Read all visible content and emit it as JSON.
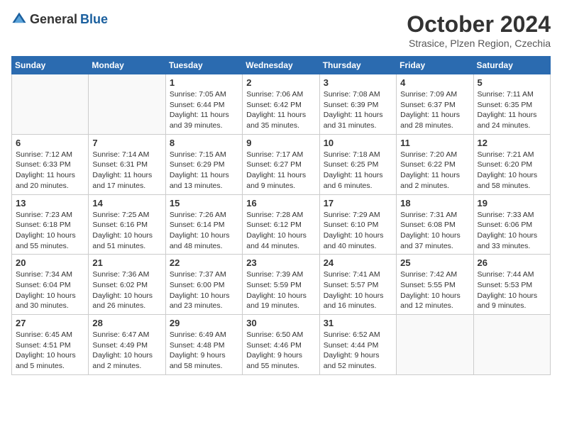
{
  "header": {
    "logo_general": "General",
    "logo_blue": "Blue",
    "month_title": "October 2024",
    "subtitle": "Strasice, Plzen Region, Czechia"
  },
  "calendar": {
    "days_of_week": [
      "Sunday",
      "Monday",
      "Tuesday",
      "Wednesday",
      "Thursday",
      "Friday",
      "Saturday"
    ],
    "weeks": [
      [
        {
          "day": "",
          "info": ""
        },
        {
          "day": "",
          "info": ""
        },
        {
          "day": "1",
          "info": "Sunrise: 7:05 AM\nSunset: 6:44 PM\nDaylight: 11 hours\nand 39 minutes."
        },
        {
          "day": "2",
          "info": "Sunrise: 7:06 AM\nSunset: 6:42 PM\nDaylight: 11 hours\nand 35 minutes."
        },
        {
          "day": "3",
          "info": "Sunrise: 7:08 AM\nSunset: 6:39 PM\nDaylight: 11 hours\nand 31 minutes."
        },
        {
          "day": "4",
          "info": "Sunrise: 7:09 AM\nSunset: 6:37 PM\nDaylight: 11 hours\nand 28 minutes."
        },
        {
          "day": "5",
          "info": "Sunrise: 7:11 AM\nSunset: 6:35 PM\nDaylight: 11 hours\nand 24 minutes."
        }
      ],
      [
        {
          "day": "6",
          "info": "Sunrise: 7:12 AM\nSunset: 6:33 PM\nDaylight: 11 hours\nand 20 minutes."
        },
        {
          "day": "7",
          "info": "Sunrise: 7:14 AM\nSunset: 6:31 PM\nDaylight: 11 hours\nand 17 minutes."
        },
        {
          "day": "8",
          "info": "Sunrise: 7:15 AM\nSunset: 6:29 PM\nDaylight: 11 hours\nand 13 minutes."
        },
        {
          "day": "9",
          "info": "Sunrise: 7:17 AM\nSunset: 6:27 PM\nDaylight: 11 hours\nand 9 minutes."
        },
        {
          "day": "10",
          "info": "Sunrise: 7:18 AM\nSunset: 6:25 PM\nDaylight: 11 hours\nand 6 minutes."
        },
        {
          "day": "11",
          "info": "Sunrise: 7:20 AM\nSunset: 6:22 PM\nDaylight: 11 hours\nand 2 minutes."
        },
        {
          "day": "12",
          "info": "Sunrise: 7:21 AM\nSunset: 6:20 PM\nDaylight: 10 hours\nand 58 minutes."
        }
      ],
      [
        {
          "day": "13",
          "info": "Sunrise: 7:23 AM\nSunset: 6:18 PM\nDaylight: 10 hours\nand 55 minutes."
        },
        {
          "day": "14",
          "info": "Sunrise: 7:25 AM\nSunset: 6:16 PM\nDaylight: 10 hours\nand 51 minutes."
        },
        {
          "day": "15",
          "info": "Sunrise: 7:26 AM\nSunset: 6:14 PM\nDaylight: 10 hours\nand 48 minutes."
        },
        {
          "day": "16",
          "info": "Sunrise: 7:28 AM\nSunset: 6:12 PM\nDaylight: 10 hours\nand 44 minutes."
        },
        {
          "day": "17",
          "info": "Sunrise: 7:29 AM\nSunset: 6:10 PM\nDaylight: 10 hours\nand 40 minutes."
        },
        {
          "day": "18",
          "info": "Sunrise: 7:31 AM\nSunset: 6:08 PM\nDaylight: 10 hours\nand 37 minutes."
        },
        {
          "day": "19",
          "info": "Sunrise: 7:33 AM\nSunset: 6:06 PM\nDaylight: 10 hours\nand 33 minutes."
        }
      ],
      [
        {
          "day": "20",
          "info": "Sunrise: 7:34 AM\nSunset: 6:04 PM\nDaylight: 10 hours\nand 30 minutes."
        },
        {
          "day": "21",
          "info": "Sunrise: 7:36 AM\nSunset: 6:02 PM\nDaylight: 10 hours\nand 26 minutes."
        },
        {
          "day": "22",
          "info": "Sunrise: 7:37 AM\nSunset: 6:00 PM\nDaylight: 10 hours\nand 23 minutes."
        },
        {
          "day": "23",
          "info": "Sunrise: 7:39 AM\nSunset: 5:59 PM\nDaylight: 10 hours\nand 19 minutes."
        },
        {
          "day": "24",
          "info": "Sunrise: 7:41 AM\nSunset: 5:57 PM\nDaylight: 10 hours\nand 16 minutes."
        },
        {
          "day": "25",
          "info": "Sunrise: 7:42 AM\nSunset: 5:55 PM\nDaylight: 10 hours\nand 12 minutes."
        },
        {
          "day": "26",
          "info": "Sunrise: 7:44 AM\nSunset: 5:53 PM\nDaylight: 10 hours\nand 9 minutes."
        }
      ],
      [
        {
          "day": "27",
          "info": "Sunrise: 6:45 AM\nSunset: 4:51 PM\nDaylight: 10 hours\nand 5 minutes."
        },
        {
          "day": "28",
          "info": "Sunrise: 6:47 AM\nSunset: 4:49 PM\nDaylight: 10 hours\nand 2 minutes."
        },
        {
          "day": "29",
          "info": "Sunrise: 6:49 AM\nSunset: 4:48 PM\nDaylight: 9 hours\nand 58 minutes."
        },
        {
          "day": "30",
          "info": "Sunrise: 6:50 AM\nSunset: 4:46 PM\nDaylight: 9 hours\nand 55 minutes."
        },
        {
          "day": "31",
          "info": "Sunrise: 6:52 AM\nSunset: 4:44 PM\nDaylight: 9 hours\nand 52 minutes."
        },
        {
          "day": "",
          "info": ""
        },
        {
          "day": "",
          "info": ""
        }
      ]
    ]
  }
}
